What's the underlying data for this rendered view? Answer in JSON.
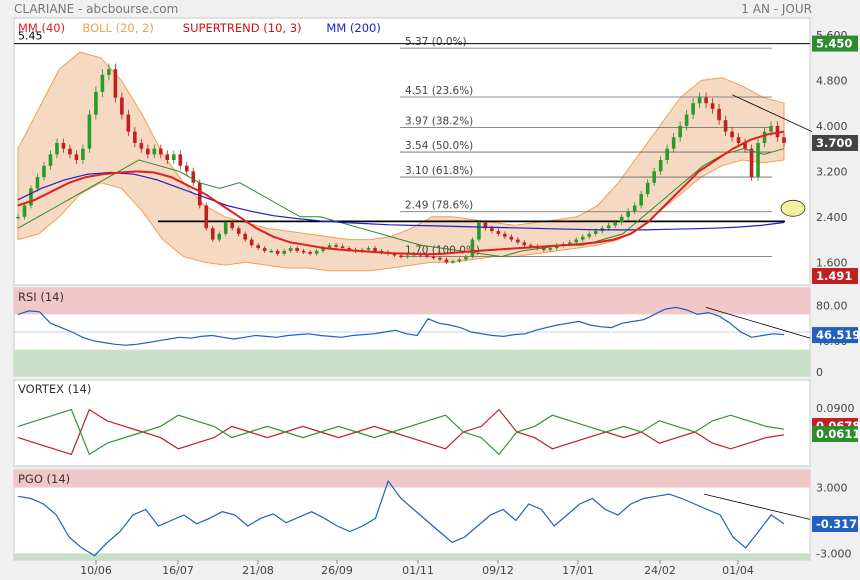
{
  "header": {
    "title": "CLARIANE - abcbourse.com",
    "period": "1 AN - JOUR"
  },
  "chart_data": {
    "type": "candlestick",
    "x_tick_labels": [
      "10/06",
      "16/07",
      "21/08",
      "26/09",
      "01/11",
      "09/12",
      "17/01",
      "24/02",
      "01/04"
    ],
    "price_panel": {
      "legend": [
        {
          "label": "MM (40)",
          "color": "#e02020"
        },
        {
          "label": "BOLL (20, 2)",
          "color": "#f0a050"
        },
        {
          "label": "SUPERTREND (10, 3)",
          "color": "#d01010"
        },
        {
          "label": "MM (200)",
          "color": "#2020c0"
        }
      ],
      "y_ticks": [
        "5.600",
        "4.800",
        "4.000",
        "3.200",
        "2.400",
        "1.600"
      ],
      "ylim": [
        1.2,
        5.9
      ],
      "last_price": "3.700",
      "high_label": "5.450",
      "low_label": "1.491",
      "high_value_text": "5.45",
      "fibonacci": [
        {
          "price": 5.37,
          "label": "5.37",
          "pct": "(0.0%)"
        },
        {
          "price": 4.51,
          "label": "4.51",
          "pct": "(23.6%)"
        },
        {
          "price": 3.97,
          "label": "3.97",
          "pct": "(38.2%)"
        },
        {
          "price": 3.54,
          "label": "3.54",
          "pct": "(50.0%)"
        },
        {
          "price": 3.1,
          "label": "3.10",
          "pct": "(61.8%)"
        },
        {
          "price": 2.49,
          "label": "2.49",
          "pct": "(78.6%)"
        },
        {
          "price": 1.7,
          "label": "1.70",
          "pct": "(100.0%)"
        }
      ],
      "close_series": [
        2.4,
        2.6,
        2.9,
        3.1,
        3.3,
        3.5,
        3.7,
        3.6,
        3.5,
        3.4,
        3.6,
        4.2,
        4.6,
        4.9,
        5.0,
        4.5,
        4.2,
        3.9,
        3.7,
        3.6,
        3.5,
        3.6,
        3.5,
        3.4,
        3.5,
        3.3,
        3.2,
        3.0,
        2.6,
        2.2,
        2.0,
        2.1,
        2.3,
        2.2,
        2.1,
        2.0,
        1.9,
        1.85,
        1.8,
        1.8,
        1.75,
        1.8,
        1.85,
        1.8,
        1.78,
        1.75,
        1.8,
        1.85,
        1.9,
        1.88,
        1.85,
        1.82,
        1.8,
        1.82,
        1.85,
        1.8,
        1.78,
        1.75,
        1.72,
        1.7,
        1.72,
        1.75,
        1.72,
        1.7,
        1.68,
        1.65,
        1.6,
        1.62,
        1.65,
        1.7,
        2.0,
        2.3,
        2.2,
        2.15,
        2.1,
        2.05,
        2.0,
        1.95,
        1.9,
        1.88,
        1.85,
        1.82,
        1.85,
        1.9,
        1.92,
        1.95,
        2.0,
        2.05,
        2.1,
        2.15,
        2.2,
        2.25,
        2.3,
        2.4,
        2.5,
        2.6,
        2.8,
        3.0,
        3.2,
        3.4,
        3.6,
        3.8,
        4.0,
        4.2,
        4.4,
        4.5,
        4.4,
        4.3,
        4.1,
        3.9,
        3.8,
        3.7,
        3.6,
        3.1,
        3.7,
        3.9,
        4.0,
        3.8,
        3.7
      ],
      "mm40": [
        2.6,
        2.7,
        2.85,
        3.0,
        3.1,
        3.15,
        3.18,
        3.2,
        3.18,
        3.1,
        2.95,
        2.8,
        2.6,
        2.4,
        2.2,
        2.05,
        1.95,
        1.9,
        1.85,
        1.82,
        1.8,
        1.78,
        1.76,
        1.75,
        1.74,
        1.75,
        1.78,
        1.8,
        1.82,
        1.84,
        1.86,
        1.88,
        1.9,
        1.92,
        1.95,
        2.0,
        2.1,
        2.3,
        2.6,
        2.9,
        3.2,
        3.4,
        3.6,
        3.75,
        3.85,
        3.9
      ],
      "mm200": [
        2.7,
        2.9,
        3.05,
        3.15,
        3.18,
        3.15,
        3.05,
        2.9,
        2.75,
        2.6,
        2.5,
        2.42,
        2.37,
        2.33,
        2.3,
        2.28,
        2.26,
        2.25,
        2.24,
        2.23,
        2.22,
        2.21,
        2.2,
        2.19,
        2.18,
        2.17,
        2.17,
        2.17,
        2.18,
        2.19,
        2.2,
        2.22,
        2.25,
        2.3
      ],
      "boll_upper": [
        3.6,
        4.3,
        5.0,
        5.3,
        5.2,
        4.8,
        4.2,
        3.5,
        3.0,
        2.6,
        2.4,
        2.3,
        2.2,
        2.15,
        2.1,
        2.05,
        2.0,
        2.0,
        2.05,
        2.2,
        2.4,
        2.4,
        2.35,
        2.3,
        2.25,
        2.3,
        2.35,
        2.4,
        2.6,
        3.0,
        3.5,
        4.0,
        4.5,
        4.8,
        4.85,
        4.7,
        4.5,
        4.4
      ],
      "boll_lower": [
        2.0,
        2.1,
        2.4,
        2.8,
        3.0,
        2.9,
        2.5,
        2.0,
        1.7,
        1.6,
        1.55,
        1.6,
        1.55,
        1.5,
        1.5,
        1.45,
        1.45,
        1.45,
        1.5,
        1.55,
        1.6,
        1.6,
        1.65,
        1.7,
        1.7,
        1.75,
        1.8,
        1.85,
        1.9,
        2.0,
        2.2,
        2.5,
        2.8,
        3.1,
        3.3,
        3.4,
        3.35,
        3.4
      ],
      "supertrend": [
        2.2,
        2.4,
        2.6,
        2.8,
        3.0,
        3.2,
        3.4,
        3.3,
        3.2,
        3.0,
        2.9,
        3.0,
        2.8,
        2.6,
        2.4,
        2.4,
        2.3,
        2.2,
        2.1,
        2.0,
        1.9,
        1.85,
        1.8,
        1.75,
        1.7,
        1.8,
        1.85,
        1.9,
        1.9,
        2.0,
        2.1,
        2.4,
        2.7,
        3.0,
        3.3,
        3.5,
        3.6,
        3.5,
        3.6
      ]
    },
    "rsi_panel": {
      "title": "RSI (14)",
      "y_ticks": [
        "80.00",
        "40.00",
        "0"
      ],
      "ylim": [
        0,
        100
      ],
      "last_value": "46.519",
      "values": [
        70,
        74,
        73,
        60,
        55,
        50,
        44,
        40,
        38,
        36,
        35,
        36,
        38,
        40,
        42,
        44,
        43,
        45,
        46,
        44,
        42,
        44,
        46,
        45,
        44,
        46,
        47,
        48,
        46,
        45,
        44,
        46,
        47,
        48,
        50,
        52,
        48,
        46,
        65,
        60,
        58,
        55,
        50,
        48,
        46,
        45,
        47,
        48,
        52,
        55,
        58,
        60,
        62,
        58,
        56,
        55,
        60,
        62,
        64,
        70,
        76,
        78,
        75,
        70,
        72,
        68,
        60,
        50,
        44,
        46,
        48,
        47
      ]
    },
    "vortex_panel": {
      "title": "VORTEX (14)",
      "y_ticks": [
        "0.0900"
      ],
      "last_red": "0.0678",
      "last_green": "0.0611",
      "red_values": [
        0.4,
        0.3,
        0.2,
        0.1,
        0.9,
        0.7,
        0.6,
        0.5,
        0.4,
        0.2,
        0.3,
        0.4,
        0.6,
        0.5,
        0.4,
        0.5,
        0.6,
        0.5,
        0.4,
        0.5,
        0.6,
        0.5,
        0.4,
        0.3,
        0.2,
        0.5,
        0.6,
        0.9,
        0.5,
        0.4,
        0.2,
        0.3,
        0.4,
        0.5,
        0.4,
        0.5,
        0.3,
        0.4,
        0.5,
        0.3,
        0.2,
        0.3,
        0.4,
        0.45
      ],
      "green_values": [
        0.6,
        0.7,
        0.8,
        0.9,
        0.1,
        0.3,
        0.4,
        0.5,
        0.6,
        0.8,
        0.7,
        0.6,
        0.4,
        0.5,
        0.6,
        0.5,
        0.4,
        0.5,
        0.6,
        0.5,
        0.4,
        0.5,
        0.6,
        0.7,
        0.8,
        0.5,
        0.4,
        0.1,
        0.5,
        0.6,
        0.8,
        0.7,
        0.6,
        0.5,
        0.6,
        0.5,
        0.7,
        0.6,
        0.5,
        0.7,
        0.8,
        0.7,
        0.6,
        0.55
      ]
    },
    "pgo_panel": {
      "title": "PGO (14)",
      "y_ticks": [
        "3.000",
        "-3.000"
      ],
      "ylim": [
        -3.6,
        4.6
      ],
      "last_value": "-0.3176",
      "values": [
        2.2,
        2.0,
        1.5,
        0.5,
        -1.5,
        -2.5,
        -3.2,
        -2.0,
        -1.0,
        0.5,
        1.0,
        -0.5,
        0.0,
        0.5,
        -0.3,
        0.2,
        0.8,
        0.5,
        -0.5,
        0.2,
        0.6,
        -0.2,
        0.3,
        0.8,
        0.2,
        -0.5,
        -1.0,
        -0.5,
        0.2,
        3.6,
        2.0,
        1.0,
        0.0,
        -1.0,
        -2.0,
        -1.5,
        -0.5,
        0.5,
        1.0,
        0.0,
        1.5,
        1.0,
        -0.5,
        0.5,
        1.5,
        2.0,
        1.0,
        0.5,
        1.5,
        2.0,
        2.2,
        2.4,
        2.0,
        1.5,
        1.0,
        0.5,
        -1.5,
        -2.5,
        -1.0,
        0.5,
        -0.3
      ]
    }
  }
}
